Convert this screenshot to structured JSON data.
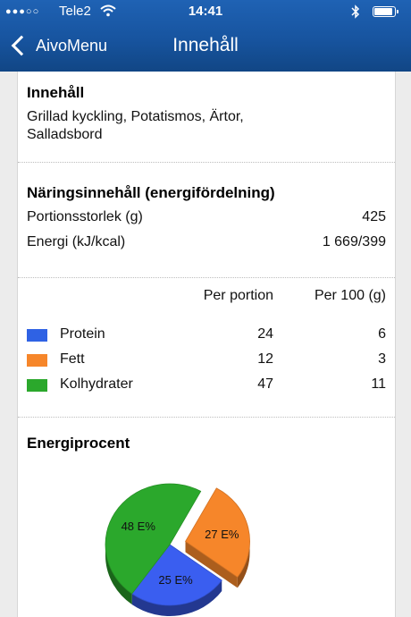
{
  "status_bar": {
    "signal": "●●●○○",
    "carrier": "Tele2",
    "time": "14:41",
    "battery_level": 0.9
  },
  "nav": {
    "back_label": "AivoMenu",
    "title": "Innehåll"
  },
  "content": {
    "heading": "Innehåll",
    "description_line1": "Grillad kyckling, Potatismos, Ärtor,",
    "description_line2": "Salladsbord"
  },
  "nutrition": {
    "heading": "Näringsinnehåll (energifördelning)",
    "portion_label": "Portionsstorlek (g)",
    "portion_value": "425",
    "energy_label": "Energi (kJ/kcal)",
    "energy_value": "1 669/399"
  },
  "macros": {
    "col_per_portion": "Per portion",
    "col_per_100": "Per 100 (g)",
    "rows": [
      {
        "label": "Protein",
        "per_portion": "24",
        "per_100": "6",
        "color": "#2f62e4"
      },
      {
        "label": "Fett",
        "per_portion": "12",
        "per_100": "3",
        "color": "#f6862a"
      },
      {
        "label": "Kolhydrater",
        "per_portion": "47",
        "per_100": "11",
        "color": "#2ba82c"
      }
    ]
  },
  "energy_percent": {
    "heading": "Energiprocent"
  },
  "chart_data": {
    "type": "pie",
    "title": "Energiprocent",
    "slices": [
      {
        "label": "27 E%",
        "value": 27,
        "color": "#f6862a",
        "exploded": true
      },
      {
        "label": "25 E%",
        "value": 25,
        "color": "#3a5ef0"
      },
      {
        "label": "48 E%",
        "value": 48,
        "color": "#2ba82c"
      }
    ],
    "style": "3d"
  }
}
